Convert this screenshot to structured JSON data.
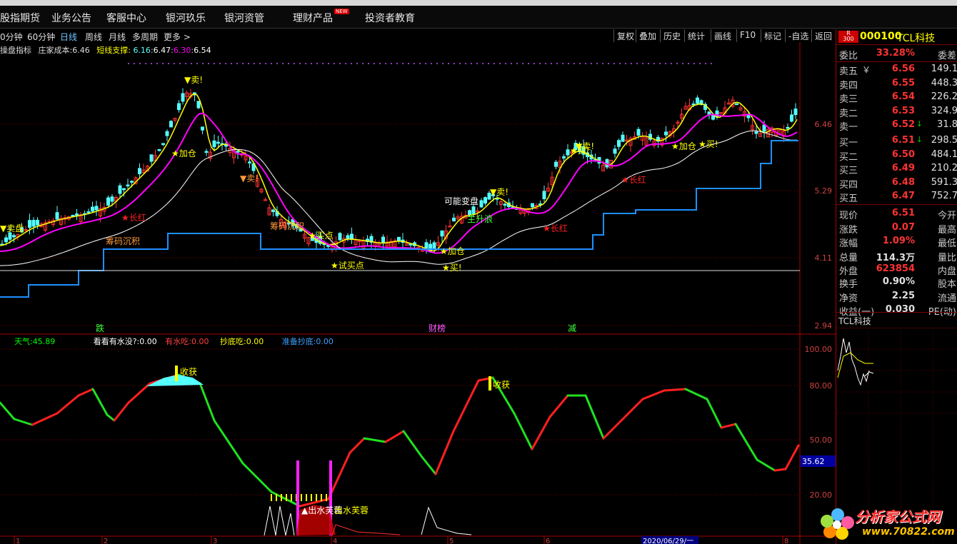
{
  "colors": {
    "up": "#ff3232",
    "down": "#00c000",
    "ma_yellow": "#ffff00",
    "ma_magenta": "#ff00ff",
    "ma_white": "#ffffff",
    "support": "#1e90ff",
    "cyan": "#54ffff",
    "accent_red": "#ff2020"
  },
  "nav": {
    "items": [
      "股指期货",
      "业务公告",
      "客服中心",
      "银河玖乐",
      "银河资管",
      "理财产品",
      "投资者教育"
    ],
    "new_badge": "NEW"
  },
  "toolbar": {
    "periods": [
      "0分钟",
      "60分钟",
      "日线",
      "周线",
      "月线",
      "多周期",
      "更多 >"
    ],
    "right_buttons": [
      "复权",
      "叠加",
      "历史",
      "统计",
      "画线",
      "F10",
      "标记",
      "-自选",
      "返回"
    ]
  },
  "chart_data": {
    "type": "candlestick",
    "price_axis": [
      "6.46",
      "5.29",
      "4.11",
      "2.94"
    ],
    "osc_axis": [
      "100.00",
      "80.00",
      "50.00",
      "35.62",
      "20.00"
    ],
    "date_ticks": [
      "1",
      "2",
      "3",
      "4",
      "5",
      "6",
      "7",
      "8"
    ],
    "date_label": "2020/06/29/一",
    "indicator_line": {
      "name": "操盘指标",
      "cost_label": "庄家成本:",
      "cost": "6.46",
      "support_label": "短线支撑:",
      "s1": "6.16",
      "s2": "6.47",
      "s3": "6.30",
      "s4": "6.54"
    },
    "osc_line": {
      "tianqi_label": "天气:",
      "tianqi": "45.89",
      "a_label": "看看有水没?:",
      "a": "0.00",
      "b_label": "有水吃:",
      "b": "0.00",
      "c_label": "抄底吃:",
      "c": "0.00",
      "d_label": "准备抄底:",
      "d": "0.00"
    },
    "annotations": [
      "卖!",
      "加仓",
      "长红",
      "筹码沉积",
      "可能变盘",
      "主升浪",
      "试买点",
      "买!",
      "卖盘",
      "筹码沉积",
      "长红",
      "长红",
      "加仓",
      "买!",
      "买点",
      "卖!",
      "买!",
      "加仓",
      "卖!",
      "卖!"
    ],
    "bottom_labels": [
      "跌",
      "财榜",
      "减"
    ],
    "osc_labels": [
      "收获",
      "收获",
      "出水芙蓉",
      "出水芙蓉"
    ]
  },
  "quote": {
    "code": "000100",
    "name": "TCL科技",
    "r_label": "R",
    "r_sub": "300",
    "weibi_label": "委比",
    "weibi": "33.28%",
    "weicha_label": "委差",
    "sell": [
      {
        "label": "卖五",
        "price": "6.56",
        "vol": "149.1"
      },
      {
        "label": "卖四",
        "price": "6.55",
        "vol": "448.3"
      },
      {
        "label": "卖三",
        "price": "6.54",
        "vol": "226.2"
      },
      {
        "label": "卖二",
        "price": "6.53",
        "vol": "324.9"
      },
      {
        "label": "卖一",
        "price": "6.52",
        "vol": "31.8"
      }
    ],
    "buy": [
      {
        "label": "买一",
        "price": "6.51",
        "vol": "298.5"
      },
      {
        "label": "买二",
        "price": "6.50",
        "vol": "484.1"
      },
      {
        "label": "买三",
        "price": "6.49",
        "vol": "210.2"
      },
      {
        "label": "买四",
        "price": "6.48",
        "vol": "591.3"
      },
      {
        "label": "买五",
        "price": "6.47",
        "vol": "752.7"
      }
    ],
    "stats": [
      {
        "l": "现价",
        "v": "6.51",
        "r": "今开"
      },
      {
        "l": "涨跌",
        "v": "0.07",
        "r": "最高"
      },
      {
        "l": "涨幅",
        "v": "1.09%",
        "r": "最低"
      },
      {
        "l": "总量",
        "v": "114.3万",
        "r": "量比"
      },
      {
        "l": "外盘",
        "v": "623854",
        "r": "内盘"
      }
    ],
    "stats2": [
      {
        "l": "换手",
        "v": "0.90%",
        "r": "股本"
      },
      {
        "l": "净资",
        "v": "2.25",
        "r": "流通"
      },
      {
        "l": "收益(一)",
        "v": "0.030",
        "r": "PE(动)"
      }
    ],
    "mini_title": "TCL科技",
    "yen": "￥"
  },
  "watermark": {
    "text": "分析家公式网",
    "url": "www.70822.com"
  }
}
